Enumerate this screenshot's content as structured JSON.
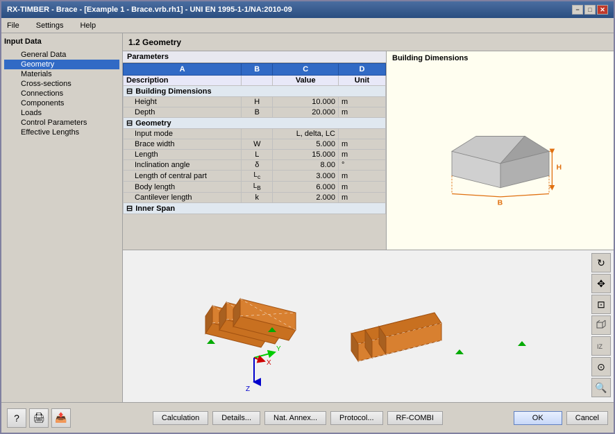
{
  "window": {
    "title": "RX-TIMBER - Brace - [Example 1 - Brace.vrb.rh1] - UNI EN 1995-1-1/NA:2010-09",
    "min_btn": "−",
    "max_btn": "□",
    "close_btn": "✕"
  },
  "menu": {
    "items": [
      "File",
      "Settings",
      "Help"
    ]
  },
  "sidebar": {
    "title": "Input Data",
    "items": [
      {
        "label": "General Data",
        "level": 1,
        "selected": false
      },
      {
        "label": "Geometry",
        "level": 1,
        "selected": true
      },
      {
        "label": "Materials",
        "level": 1,
        "selected": false
      },
      {
        "label": "Cross-sections",
        "level": 1,
        "selected": false
      },
      {
        "label": "Connections",
        "level": 1,
        "selected": false
      },
      {
        "label": "Components",
        "level": 1,
        "selected": false
      },
      {
        "label": "Loads",
        "level": 1,
        "selected": false
      },
      {
        "label": "Control Parameters",
        "level": 1,
        "selected": false
      },
      {
        "label": "Effective Lengths",
        "level": 1,
        "selected": false
      }
    ]
  },
  "section": {
    "title": "1.2 Geometry"
  },
  "params": {
    "header": "Parameters",
    "columns": [
      "A",
      "B",
      "C",
      "D"
    ],
    "col_desc": "Description",
    "col_value": "Value",
    "col_unit": "Unit",
    "groups": [
      {
        "name": "Building Dimensions",
        "rows": [
          {
            "desc": "Height",
            "sym": "H",
            "value": "10.000",
            "unit": "m"
          },
          {
            "desc": "Depth",
            "sym": "B",
            "value": "20.000",
            "unit": "m"
          }
        ]
      },
      {
        "name": "Geometry",
        "rows": [
          {
            "desc": "Input mode",
            "sym": "",
            "value": "L, delta, LC",
            "unit": ""
          },
          {
            "desc": "Brace width",
            "sym": "W",
            "value": "5.000",
            "unit": "m"
          },
          {
            "desc": "Length",
            "sym": "L",
            "value": "15.000",
            "unit": "m"
          },
          {
            "desc": "Inclination angle",
            "sym": "δ",
            "value": "8.00",
            "unit": "°"
          },
          {
            "desc": "Length of central part",
            "sym": "L_c",
            "value": "3.000",
            "unit": "m"
          },
          {
            "desc": "Body length",
            "sym": "L_B",
            "value": "6.000",
            "unit": "m"
          },
          {
            "desc": "Cantilever length",
            "sym": "k",
            "value": "2.000",
            "unit": "m"
          }
        ]
      },
      {
        "name": "Inner Span",
        "rows": []
      }
    ]
  },
  "building_dims": {
    "title": "Building Dimensions"
  },
  "bottom": {
    "calc_btn": "Calculation",
    "details_btn": "Details...",
    "nat_annex_btn": "Nat. Annex...",
    "protocol_btn": "Protocol...",
    "rf_combi_btn": "RF-COMBI",
    "ok_btn": "OK",
    "cancel_btn": "Cancel"
  },
  "viz_controls": [
    "🔄",
    "↔",
    "⊡",
    "⟲",
    "⟳",
    "⊙",
    "🔍"
  ]
}
